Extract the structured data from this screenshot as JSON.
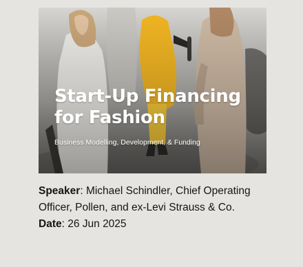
{
  "banner": {
    "title_line1": "Start-Up Financing",
    "title_line2": "for Fashion",
    "subtitle": "Business Modelling, Development, & Funding"
  },
  "details": {
    "speaker_label": "Speaker",
    "speaker_value": ": Michael Schindler, Chief Operating Officer, Pollen, and ex-Levi Strauss & Co.",
    "date_label": "Date",
    "date_value": ": 26 Jun 2025"
  },
  "colors": {
    "page_background": "#e6e4e0",
    "title_text": "#ffffff",
    "body_text": "#151515"
  }
}
